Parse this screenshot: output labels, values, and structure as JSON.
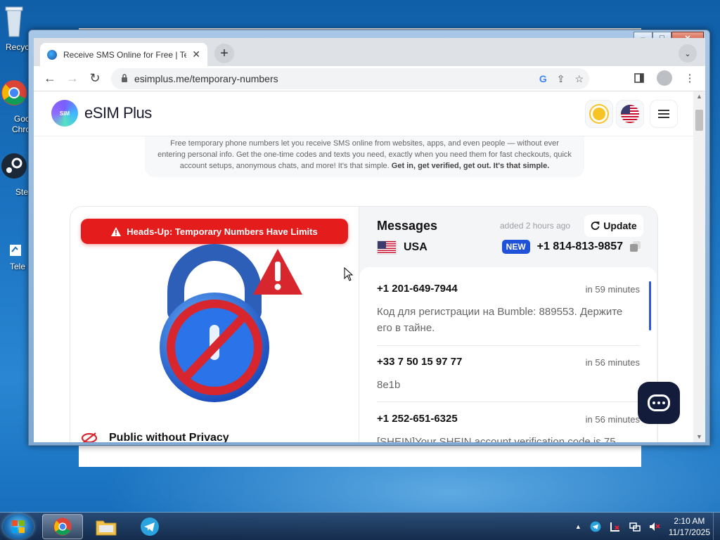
{
  "desktop": {
    "icons": [
      {
        "label": "Recyc"
      },
      {
        "label": "Goo"
      },
      {
        "label": "Chro"
      },
      {
        "label": "Ste"
      },
      {
        "label": "Tele"
      }
    ]
  },
  "window": {
    "buttons": {
      "minimize": "–",
      "maximize": "□",
      "close": "✕"
    }
  },
  "browser": {
    "tab": {
      "title": "Receive SMS Online for Free | Temporary",
      "close": "✕"
    },
    "new_tab": "+",
    "tab_search": "⌄",
    "url": "esimplus.me/temporary-numbers",
    "nav": {
      "back": "←",
      "forward": "→",
      "reload": "↻"
    },
    "omnibox_icons": [
      "google-lens-icon",
      "share-icon",
      "bookmark-star-icon"
    ],
    "toolbar_icons": [
      "side-panel-icon",
      "profile-icon",
      "menu-icon"
    ]
  },
  "site": {
    "logo": {
      "mark": "SIM",
      "name": "eSIM Plus"
    },
    "intro": {
      "text": "Free temporary phone numbers let you receive SMS online from websites, apps, and even people — without ever entering personal info. Get the one-time codes and texts you need, exactly when you need them for fast checkouts, quick account setups, anonymous chats, and more! It's that simple. ",
      "bold": "Get in, get verified, get out. It's that simple."
    },
    "alert": {
      "text": "Heads-Up: Temporary Numbers Have Limits",
      "icon": "warning-icon",
      "color": "#e41c1c"
    },
    "public_heading": "Public without Privacy",
    "messages": {
      "title": "Messages",
      "added": "added 2 hours ago",
      "update_label": "Update",
      "country": "USA",
      "new_badge": "NEW",
      "number": "+1 814-813-9857",
      "items": [
        {
          "sender": "+1 201-649-7944",
          "time": "in 59 minutes",
          "body": "Код для регистрации на Bumble: 889553. Держите его в тайне."
        },
        {
          "sender": "+33 7 50 15 97 77",
          "time": "in 56 minutes",
          "body": "8e1b"
        },
        {
          "sender": "+1 252-651-6325",
          "time": "in 56 minutes",
          "body": "[SHEIN]Your SHEIN account verification code is 75"
        }
      ]
    },
    "accent_color": "#1f52d8"
  },
  "taskbar": {
    "apps": [
      "chrome-icon",
      "explorer-icon",
      "telegram-icon"
    ],
    "clock": {
      "time": "2:10 AM",
      "date": "11/17/2025"
    }
  }
}
